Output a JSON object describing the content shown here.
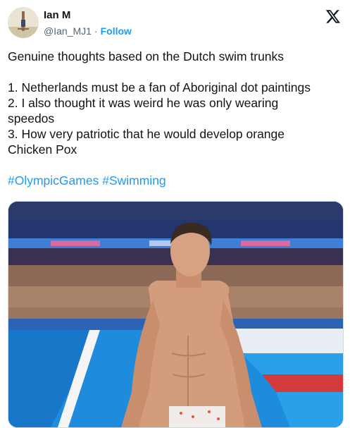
{
  "author": {
    "name": "Ian M",
    "handle": "@Ian_MJ1",
    "separator": "·",
    "follow_label": "Follow"
  },
  "tweet": {
    "line1": "Genuine thoughts based on the Dutch swim trunks",
    "items": [
      "1. Netherlands must be a fan of Aboriginal dot paintings",
      "2. I also thought it was weird he was only wearing",
      "speedos",
      "3. How very patriotic that he would develop orange",
      "Chicken Pox"
    ],
    "hashtags": [
      "#OlympicGames",
      "#Swimming"
    ]
  },
  "colors": {
    "accent": "#1d9bf0",
    "text": "#0f1419",
    "muted": "#536471"
  },
  "icons": {
    "logo": "x-logo-icon"
  }
}
